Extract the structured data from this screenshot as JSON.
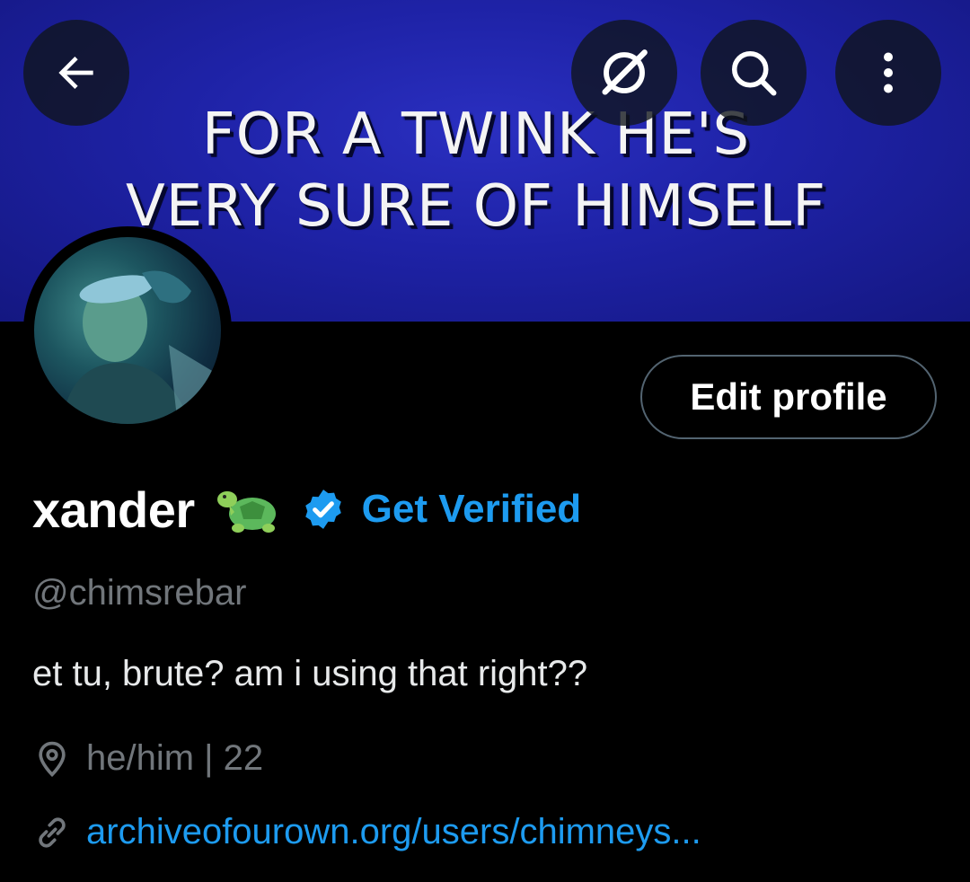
{
  "banner": {
    "line1": "FOR A TWINK HE'S",
    "line2": "VERY SURE OF HIMSELF"
  },
  "header_icons": {
    "back": "arrow-left-icon",
    "grok": "grok-icon",
    "search": "search-icon",
    "more": "more-vertical-icon"
  },
  "profile": {
    "edit_label": "Edit profile",
    "display_name": "xander",
    "emoji": "🐢",
    "get_verified_label": "Get Verified",
    "handle": "@chimsrebar",
    "bio": "et tu, brute? am i using that right??",
    "location": "he/him | 22",
    "link": "archiveofourown.org/users/chimneys..."
  },
  "colors": {
    "accent": "#1d9bf0",
    "secondary_text": "#71767b",
    "banner_blue": "#1e22a6"
  }
}
